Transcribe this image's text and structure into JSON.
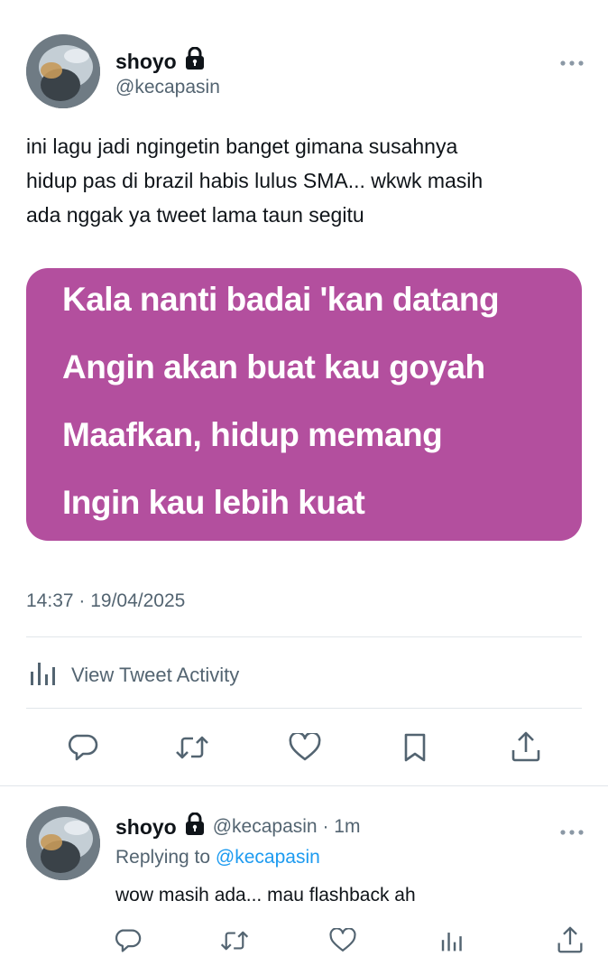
{
  "tweet": {
    "author_name": "shoyo",
    "author_handle": "@kecapasin",
    "text": "ini lagu jadi ngingetin banget gimana susahnya hidup pas di brazil habis lulus SMA... wkwk masih ada nggak ya tweet lama taun segitu",
    "text_lines": [
      "ini lagu jadi ngingetin banget gimana susahnya",
      "hidup pas di brazil habis lulus SMA... wkwk masih",
      "ada nggak ya tweet lama taun segitu"
    ],
    "lyrics": [
      "Kala nanti badai 'kan datang",
      "Angin akan buat kau goyah",
      "Maafkan, hidup memang",
      "Ingin kau lebih kuat"
    ],
    "lyric_card_color": "#b34f9e",
    "timestamp": "14:37 · 19/04/2025",
    "activity_label": "View Tweet Activity",
    "more_icon": "more-dots-icon",
    "actions": [
      "reply-icon",
      "retweet-icon",
      "like-icon",
      "bookmark-icon",
      "share-icon"
    ]
  },
  "reply": {
    "author_name": "shoyo",
    "author_handle_time": "@kecapasin · 1m",
    "replying_prefix": "Replying to",
    "replying_handle": "@kecapasin",
    "text": "wow masih ada... mau flashback ah",
    "actions": [
      "reply-icon",
      "retweet-icon",
      "like-icon",
      "views-icon",
      "share-icon"
    ]
  },
  "colors": {
    "text": "#0f1419",
    "secondary": "#536471",
    "link": "#1d9bf0"
  }
}
